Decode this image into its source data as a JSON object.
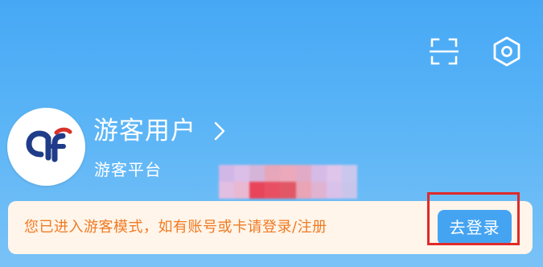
{
  "header": {
    "icons": [
      "scan-icon",
      "settings-icon"
    ]
  },
  "profile": {
    "name": "游客用户",
    "subtitle": "游客平台",
    "avatar_icon": "logo-af-icon"
  },
  "notice": {
    "text": "您已进入游客模式，如有账号或卡请登录/注册",
    "login_label": "去登录"
  },
  "colors": {
    "background_top": "#46a8f5",
    "notice_bg": "#fff5ea",
    "notice_text": "#f07a22",
    "button_bg": "#45a4f2",
    "highlight": "#e02a2a",
    "logo_blue": "#1f3c8a",
    "logo_red": "#d9312b"
  }
}
